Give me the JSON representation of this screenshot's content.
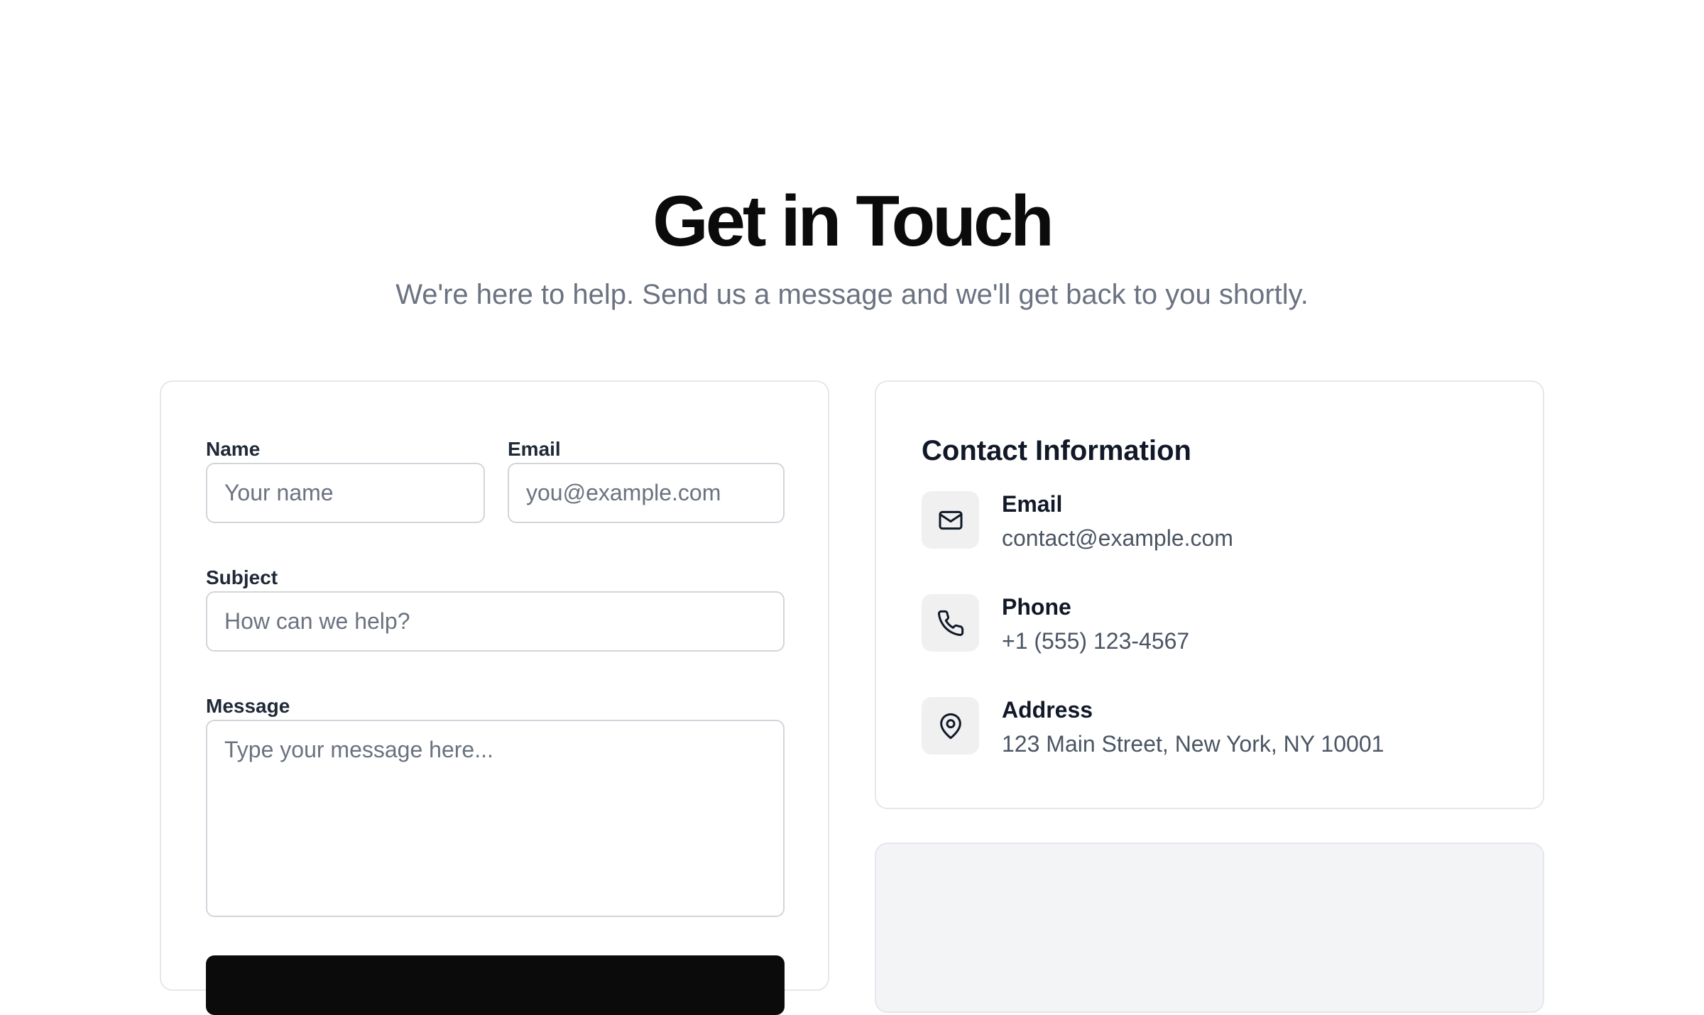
{
  "header": {
    "title": "Get in Touch",
    "subtitle": "We're here to help. Send us a message and we'll get back to you shortly."
  },
  "form": {
    "name": {
      "label": "Name",
      "placeholder": "Your name",
      "value": ""
    },
    "email": {
      "label": "Email",
      "placeholder": "you@example.com",
      "value": ""
    },
    "subject": {
      "label": "Subject",
      "placeholder": "How can we help?",
      "value": ""
    },
    "message": {
      "label": "Message",
      "placeholder": "Type your message here...",
      "value": ""
    },
    "submit_label": ""
  },
  "contact_info": {
    "title": "Contact Information",
    "items": [
      {
        "icon": "mail-icon",
        "label": "Email",
        "value": "contact@example.com"
      },
      {
        "icon": "phone-icon",
        "label": "Phone",
        "value": "+1 (555) 123-4567"
      },
      {
        "icon": "map-pin-icon",
        "label": "Address",
        "value": "123 Main Street, New York, NY 10001"
      }
    ]
  },
  "colors": {
    "primary_button": "#0b0b0c",
    "muted_text": "#6b7280",
    "icon_tile": "#f0f0f1",
    "border": "#e5e7eb",
    "map_placeholder": "#f3f4f6"
  }
}
